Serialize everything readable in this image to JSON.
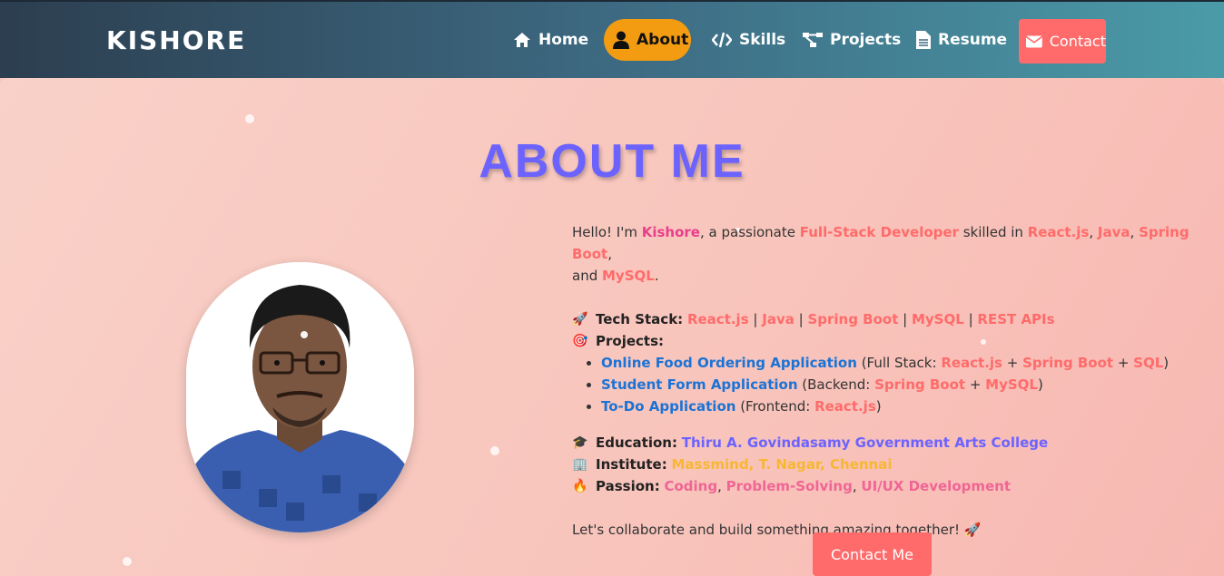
{
  "nav": {
    "brand": "KISHORE",
    "items": [
      {
        "label": "Home",
        "icon": "home-icon"
      },
      {
        "label": "About",
        "icon": "user-icon",
        "active": true
      },
      {
        "label": "Skills",
        "icon": "code-icon"
      },
      {
        "label": "Projects",
        "icon": "project-diagram-icon"
      },
      {
        "label": "Resume",
        "icon": "file-icon"
      },
      {
        "label": "Contact",
        "icon": "envelope-icon"
      }
    ]
  },
  "about": {
    "title": "ABOUT ME",
    "intro": {
      "p1": "Hello! I'm ",
      "name": "Kishore",
      "p2": ", a passionate ",
      "role": "Full-Stack Developer",
      "p3": " skilled in ",
      "s1": "React.js",
      "c1": ", ",
      "s2": "Java",
      "c2": ", ",
      "s3": "Spring Boot",
      "c3": ",",
      "and": "and ",
      "s4": "MySQL",
      "end": "."
    },
    "tech": {
      "emoji": "🚀",
      "label": "Tech Stack:",
      "items": [
        "React.js",
        "Java",
        "Spring Boot",
        "MySQL",
        "REST APIs"
      ],
      "sep": " | "
    },
    "projects": {
      "emoji": "🎯",
      "label": "Projects:",
      "list": [
        {
          "name": "Online Food Ordering Application",
          "pre": " (Full Stack: ",
          "t1": "React.js",
          "j1": " + ",
          "t2": "Spring Boot",
          "j2": " + ",
          "t3": "SQL",
          "post": ")"
        },
        {
          "name": "Student Form Application",
          "pre": " (Backend: ",
          "t1": "Spring Boot",
          "j1": " + ",
          "t2": "MySQL",
          "post": ")"
        },
        {
          "name": "To-Do Application",
          "pre": " (Frontend: ",
          "t1": "React.js",
          "post": ")"
        }
      ]
    },
    "education": {
      "emoji": "🎓",
      "label": "Education:",
      "value": "Thiru A. Govindasamy Government Arts College"
    },
    "institute": {
      "emoji": "🏢",
      "label": "Institute:",
      "value": "Massmind, T. Nagar, Chennai"
    },
    "passion": {
      "emoji": "🔥",
      "label": "Passion:",
      "items": [
        "Coding",
        "Problem-Solving",
        "UI/UX Development"
      ],
      "sep": ", "
    },
    "closing": "Let's collaborate and build something amazing together! 🚀",
    "button": "Contact Me"
  },
  "colors": {
    "accent": "#6c63ff",
    "highlight": "#ff6b6b",
    "active_nav": "#f39c12"
  }
}
